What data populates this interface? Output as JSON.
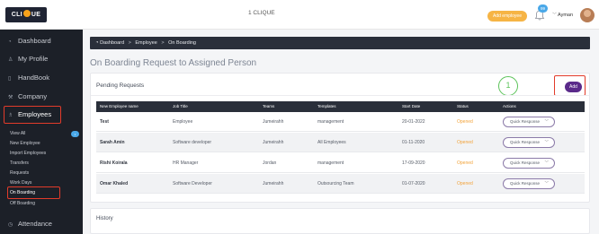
{
  "header": {
    "logo_text": "CLIQUE",
    "app_title": "1 CLIQUE",
    "add_employee_label": "Add employee",
    "notification_count": "99",
    "user_name": "Ayman"
  },
  "sidebar": {
    "items": [
      {
        "label": "Dashboard",
        "icon": "dashboard-icon"
      },
      {
        "label": "My Profile",
        "icon": "user-icon"
      },
      {
        "label": "HandBook",
        "icon": "book-icon"
      },
      {
        "label": "Company",
        "icon": "wrench-icon"
      },
      {
        "label": "Employees",
        "icon": "people-icon"
      },
      {
        "label": "Attendance",
        "icon": "clock-icon"
      }
    ],
    "subitems": [
      {
        "label": "View All"
      },
      {
        "label": "New Employee"
      },
      {
        "label": "Import Employees"
      },
      {
        "label": "Transfers"
      },
      {
        "label": "Requests"
      },
      {
        "label": "Work Days"
      },
      {
        "label": "On Boarding"
      },
      {
        "label": "Off Boarding"
      }
    ]
  },
  "breadcrumb": {
    "home": "Dashboard",
    "section": "Employee",
    "current": "On Boarding",
    "separator": ">"
  },
  "page_title": "On Boarding Request to Assigned Person",
  "pending": {
    "title": "Pending Requests",
    "annotation_number": "1",
    "add_label": "Add",
    "columns": [
      "New Employee name",
      "Job Title",
      "Teams",
      "Templates",
      "Start Date",
      "Status",
      "Actions"
    ],
    "rows": [
      {
        "name": "Test",
        "job": "Employee",
        "team": "Jumeirahh",
        "template": "management",
        "start": "20-01-2022",
        "status": "Opened",
        "action": "Quick Response"
      },
      {
        "name": "Sarah Amin",
        "job": "Software developer",
        "team": "Jumeirahh",
        "template": "All Employees",
        "start": "01-11-2020",
        "status": "Opened",
        "action": "Quick Response"
      },
      {
        "name": "Rishi Koirala",
        "job": "HR Manager",
        "team": "Jordan",
        "template": "management",
        "start": "17-09-2020",
        "status": "Opened",
        "action": "Quick Response"
      },
      {
        "name": "Omar Khaled",
        "job": "Software Developer",
        "team": "Jumeirahh",
        "template": "Outsourcing Team",
        "start": "01-07-2020",
        "status": "Opened",
        "action": "Quick Response"
      }
    ]
  },
  "history": {
    "title": "History"
  },
  "colors": {
    "sidebar_bg": "#1c2028",
    "accent_purple": "#5a2a8a",
    "status_orange": "#f2a33a",
    "annotation_red": "#e23b2a",
    "annotation_green": "#5cc35a"
  }
}
